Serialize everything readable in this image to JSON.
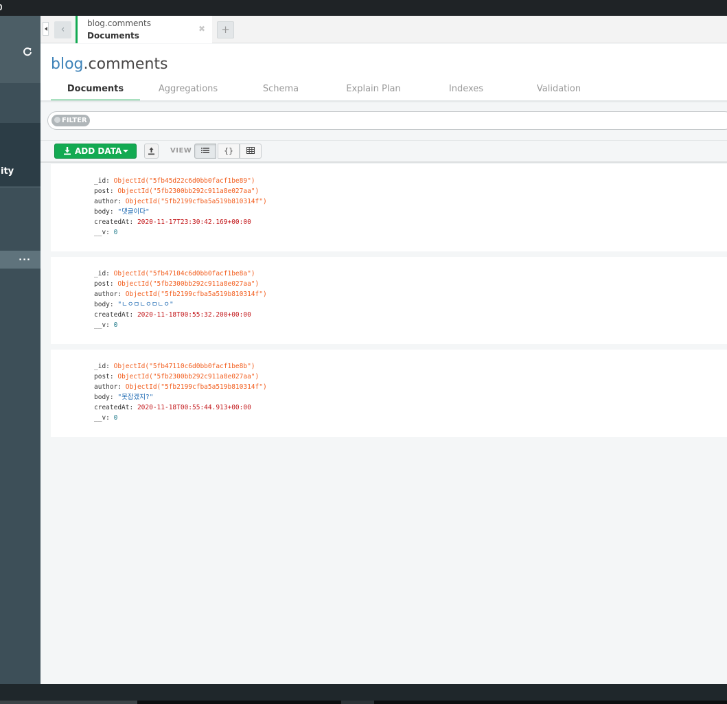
{
  "tabs": [
    {
      "namespace": "blog.comments",
      "subtitle": "Documents",
      "close_icon": "close-icon"
    }
  ],
  "sidebar": {
    "activity_label": "ity",
    "selected_menu": "...",
    "refresh_icon": "refresh-icon"
  },
  "collection": {
    "db": "blog",
    "dot": ".",
    "name": "comments"
  },
  "view_tabs": [
    "Documents",
    "Aggregations",
    "Schema",
    "Explain Plan",
    "Indexes",
    "Validation"
  ],
  "active_view_tab": "Documents",
  "filter": {
    "pill_label": "FILTER",
    "value": ""
  },
  "toolbar": {
    "add_data_label": "ADD DATA",
    "view_label": "VIEW",
    "view_modes": [
      "list",
      "json",
      "table"
    ],
    "active_view_mode": "list"
  },
  "documents": [
    {
      "fields": [
        {
          "key": "_id",
          "value": "ObjectId(\"5fb45d22c6d0bb0facf1be89\")",
          "type": "oid"
        },
        {
          "key": "post",
          "value": "ObjectId(\"5fb2300bb292c911a8e027aa\")",
          "type": "oid"
        },
        {
          "key": "author",
          "value": "ObjectId(\"5fb2199cfba5a519b810314f\")",
          "type": "oid"
        },
        {
          "key": "body",
          "value": "\"댓글이다\"",
          "type": "str"
        },
        {
          "key": "createdAt",
          "value": "2020-11-17T23:30:42.169+00:00",
          "type": "date"
        },
        {
          "key": "__v",
          "value": "0",
          "type": "num"
        }
      ]
    },
    {
      "fields": [
        {
          "key": "_id",
          "value": "ObjectId(\"5fb47104c6d0bb0facf1be8a\")",
          "type": "oid"
        },
        {
          "key": "post",
          "value": "ObjectId(\"5fb2300bb292c911a8e027aa\")",
          "type": "oid"
        },
        {
          "key": "author",
          "value": "ObjectId(\"5fb2199cfba5a519b810314f\")",
          "type": "oid"
        },
        {
          "key": "body",
          "value": "\"ㄴㅇㅁㄴㅇㅁㄴㅇ\"",
          "type": "str"
        },
        {
          "key": "createdAt",
          "value": "2020-11-18T00:55:32.200+00:00",
          "type": "date"
        },
        {
          "key": "__v",
          "value": "0",
          "type": "num"
        }
      ]
    },
    {
      "fields": [
        {
          "key": "_id",
          "value": "ObjectId(\"5fb47110c6d0bb0facf1be8b\")",
          "type": "oid"
        },
        {
          "key": "post",
          "value": "ObjectId(\"5fb2300bb292c911a8e027aa\")",
          "type": "oid"
        },
        {
          "key": "author",
          "value": "ObjectId(\"5fb2199cfba5a519b810314f\")",
          "type": "oid"
        },
        {
          "key": "body",
          "value": "\"못잡겠지?\"",
          "type": "str"
        },
        {
          "key": "createdAt",
          "value": "2020-11-18T00:55:44.913+00:00",
          "type": "date"
        },
        {
          "key": "__v",
          "value": "0",
          "type": "num"
        }
      ]
    }
  ],
  "colors": {
    "accent": "#13aa52",
    "db_name": "#3d82b8",
    "oid": "#f25b1a",
    "string": "#1a67b1",
    "date": "#c3181b",
    "number": "#217b8b",
    "sidebar": "#3d4f58"
  }
}
